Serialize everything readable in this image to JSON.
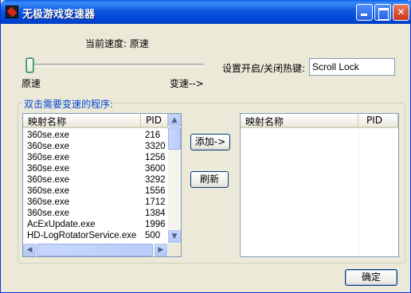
{
  "window": {
    "title": "无极游戏变速器"
  },
  "speed": {
    "current_label": "当前速度: 原速",
    "slider_min_label": "原速",
    "slider_max_label": "变速-->",
    "slider_value": 0
  },
  "hotkey": {
    "label": "设置开启/关闭热键:",
    "value": "Scroll Lock"
  },
  "group": {
    "label": "双击需要变速的程序:"
  },
  "process_list": {
    "columns": [
      "映射名称",
      "PID"
    ],
    "rows": [
      [
        "360se.exe",
        "216"
      ],
      [
        "360se.exe",
        "3320"
      ],
      [
        "360se.exe",
        "1256"
      ],
      [
        "360se.exe",
        "3600"
      ],
      [
        "360se.exe",
        "3292"
      ],
      [
        "360se.exe",
        "1556"
      ],
      [
        "360se.exe",
        "1712"
      ],
      [
        "360se.exe",
        "1384"
      ],
      [
        "AcExUpdate.exe",
        "1996"
      ],
      [
        "HD-LogRotatorService.exe",
        "500"
      ]
    ]
  },
  "selected_list": {
    "columns": [
      "映射名称",
      "PID"
    ],
    "rows": []
  },
  "buttons": {
    "add": "添加->",
    "refresh": "刷新",
    "ok": "确定"
  },
  "colors": {
    "titlebar": "#0054e3",
    "group_label": "#0046d5",
    "window_bg": "#ece9d8"
  }
}
